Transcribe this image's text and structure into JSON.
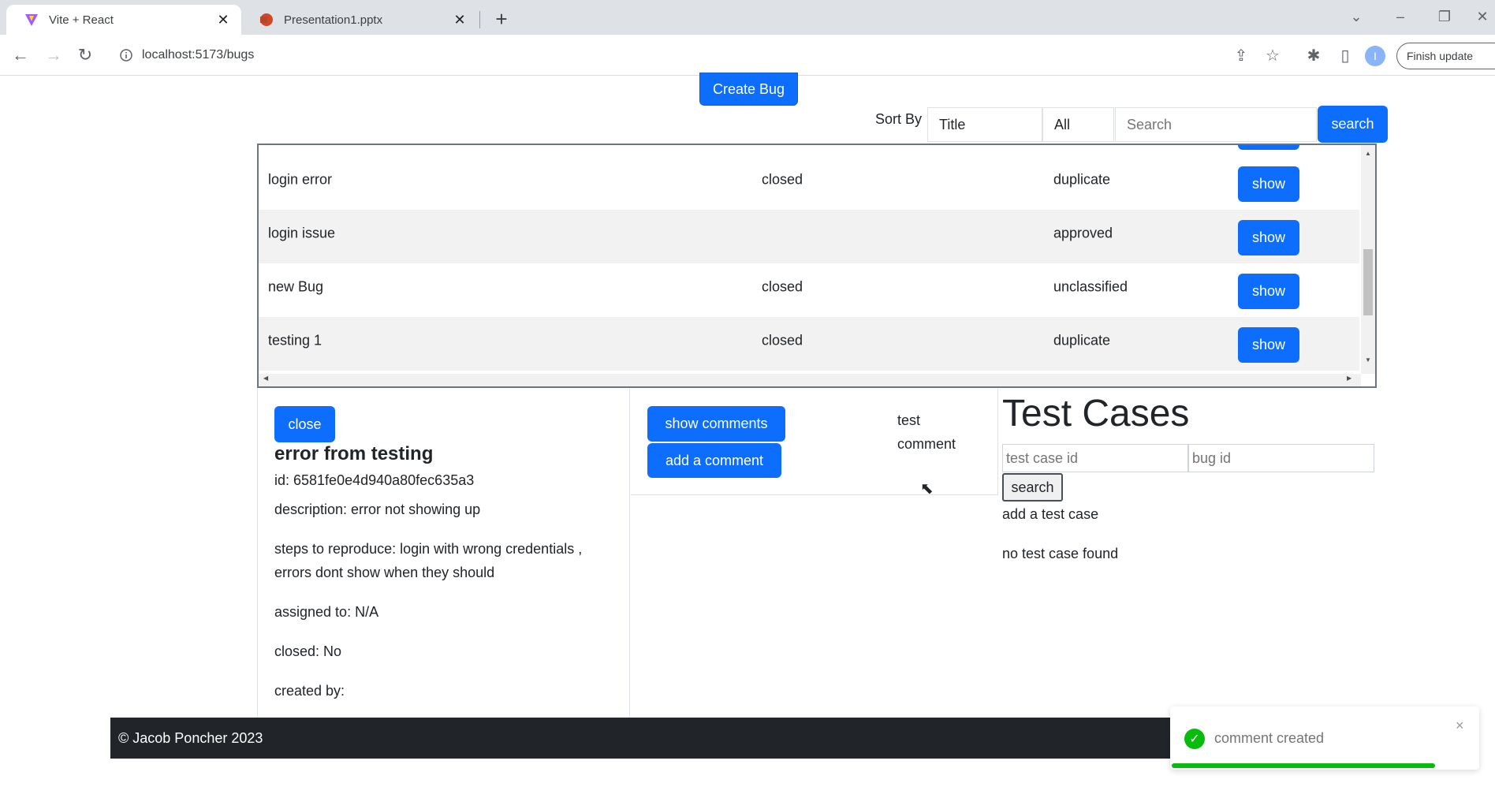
{
  "browser": {
    "tabs": [
      {
        "title": "Vite + React",
        "active": true,
        "icon": "vite-icon"
      },
      {
        "title": "Presentation1.pptx",
        "active": false,
        "icon": "powerpoint-icon"
      }
    ],
    "new_tab": "+",
    "url": "localhost:5173/bugs",
    "finish_update": "Finish update",
    "profile_initial": "I",
    "close_glyph": "✕"
  },
  "header": {
    "create_bug": "Create Bug",
    "sort_label": "Sort By",
    "sort_value": "Title",
    "filter_value": "All",
    "search_placeholder": "Search",
    "search_button": "search"
  },
  "bugs": [
    {
      "title": "login error",
      "status": "closed",
      "classification": "duplicate",
      "action": "show"
    },
    {
      "title": "login issue",
      "status": "",
      "classification": "approved",
      "action": "show"
    },
    {
      "title": "new Bug",
      "status": "closed",
      "classification": "unclassified",
      "action": "show"
    },
    {
      "title": "testing 1",
      "status": "closed",
      "classification": "duplicate",
      "action": "show"
    }
  ],
  "detail": {
    "close": "close",
    "title": "error from testing",
    "id": "id: 6581fe0e4d940a80fec635a3",
    "description": "description: error not showing up",
    "steps": "steps to reproduce: login with wrong credentials , errors dont show when they should",
    "assigned": "assigned to: N/A",
    "closed": "closed: No",
    "created_by": "created by:"
  },
  "comments": {
    "show_comments": "show comments",
    "add_comment": "add a comment",
    "comment_text": "test comment"
  },
  "test_cases": {
    "title": "Test Cases",
    "case_id_placeholder": "test case id",
    "bug_id_placeholder": "bug id",
    "search": "search",
    "add_case": "add a test case",
    "empty": "no test case found"
  },
  "footer": {
    "text": "© Jacob Poncher 2023"
  },
  "toast": {
    "message": "comment created",
    "close": "×",
    "check": "✓"
  },
  "colors": {
    "primary": "#0d6efd",
    "footer_bg": "#212529",
    "success": "#07bc0c"
  }
}
